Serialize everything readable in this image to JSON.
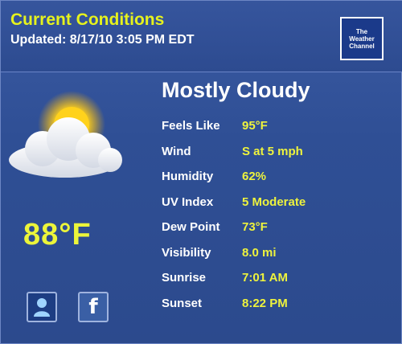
{
  "header": {
    "title": "Current Conditions",
    "updated": "Updated: 8/17/10 3:05 PM EDT",
    "logo": [
      "The",
      "Weather",
      "Channel"
    ]
  },
  "current": {
    "icon": "partly-cloudy-icon",
    "temperature": "88°F",
    "condition": "Mostly Cloudy"
  },
  "details": [
    {
      "label": "Feels Like",
      "value": "95°F"
    },
    {
      "label": "Wind",
      "value": "S at 5 mph"
    },
    {
      "label": "Humidity",
      "value": "62%"
    },
    {
      "label": "UV Index",
      "value": "5 Moderate"
    },
    {
      "label": "Dew Point",
      "value": "73°F"
    },
    {
      "label": "Visibility",
      "value": "8.0 mi"
    },
    {
      "label": "Sunrise",
      "value": "7:01 AM"
    },
    {
      "label": "Sunset",
      "value": "8:22 PM"
    }
  ],
  "share": {
    "buttons": [
      "person-icon",
      "facebook-icon"
    ]
  },
  "colors": {
    "background": "#2f4f95",
    "accent_yellow": "#e6f21d",
    "text_white": "#ffffff"
  }
}
